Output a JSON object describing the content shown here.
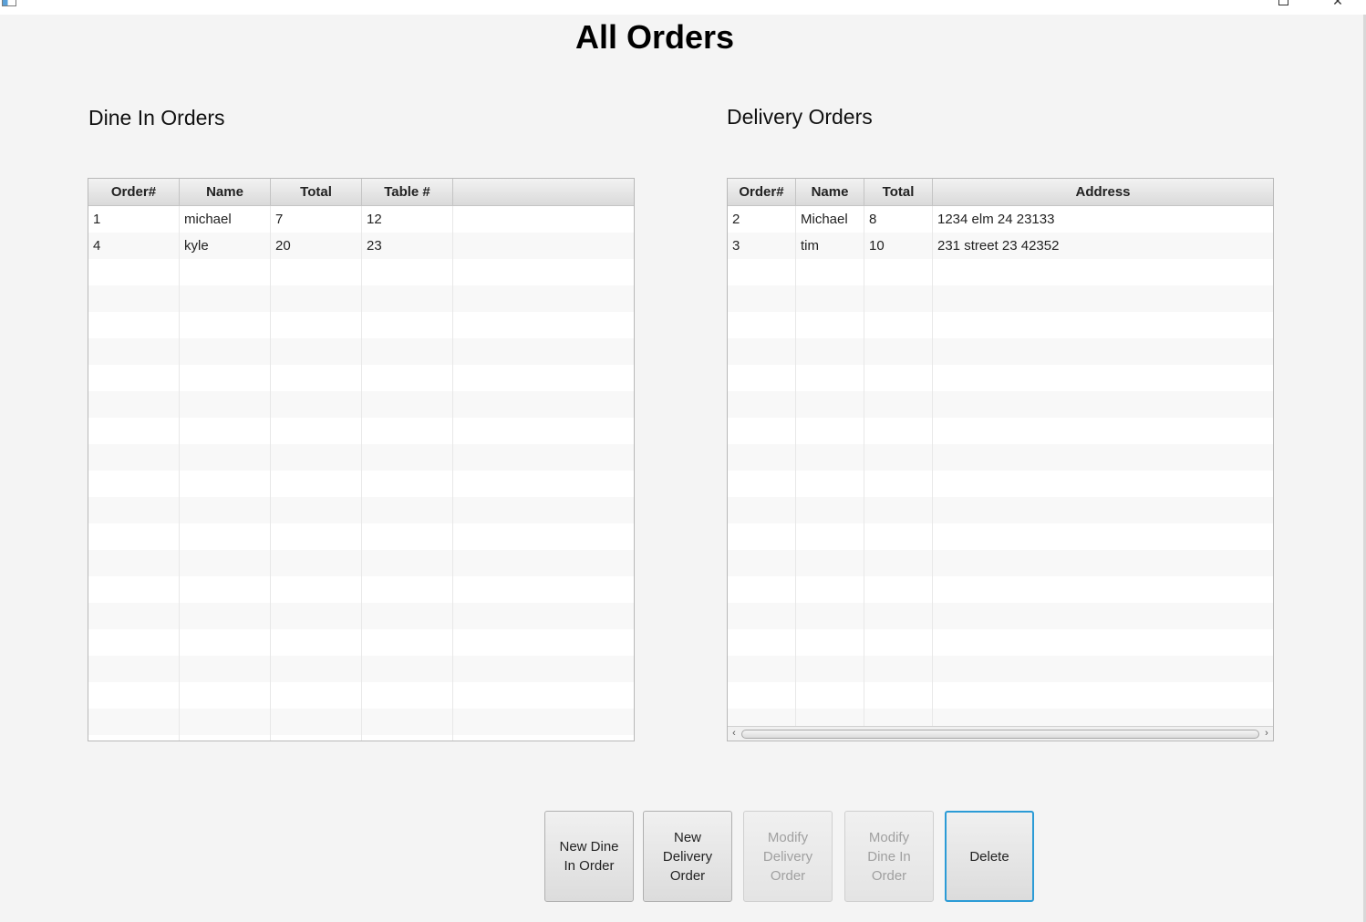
{
  "window": {
    "icons": [
      "app-icon",
      "restore-icon",
      "close-icon"
    ],
    "close_glyph": "✕"
  },
  "page": {
    "title": "All Orders"
  },
  "dine_in": {
    "title": "Dine In Orders",
    "columns": [
      "Order#",
      "Name",
      "Total",
      "Table #",
      ""
    ],
    "rows": [
      [
        "1",
        "michael",
        "7",
        "12",
        ""
      ],
      [
        "4",
        "kyle",
        "20",
        "23",
        ""
      ]
    ]
  },
  "delivery": {
    "title": "Delivery Orders",
    "columns": [
      "Order#",
      "Name",
      "Total",
      "Address"
    ],
    "rows": [
      [
        "2",
        "Michael",
        "8",
        "1234 elm 24 23133"
      ],
      [
        "3",
        "tim",
        "10",
        "231 street 23 42352"
      ]
    ]
  },
  "buttons": {
    "new_dine_in": [
      "New Dine",
      "In Order"
    ],
    "new_delivery": [
      "New",
      "Delivery",
      "Order"
    ],
    "modify_delivery": [
      "Modify",
      "Delivery",
      "Order"
    ],
    "modify_dine_in": [
      "Modify",
      "Dine In",
      "Order"
    ],
    "delete": [
      "Delete"
    ]
  },
  "colors": {
    "background": "#f4f4f4",
    "focus_border": "#2b9bd6",
    "disabled_text": "#a0a0a0"
  }
}
